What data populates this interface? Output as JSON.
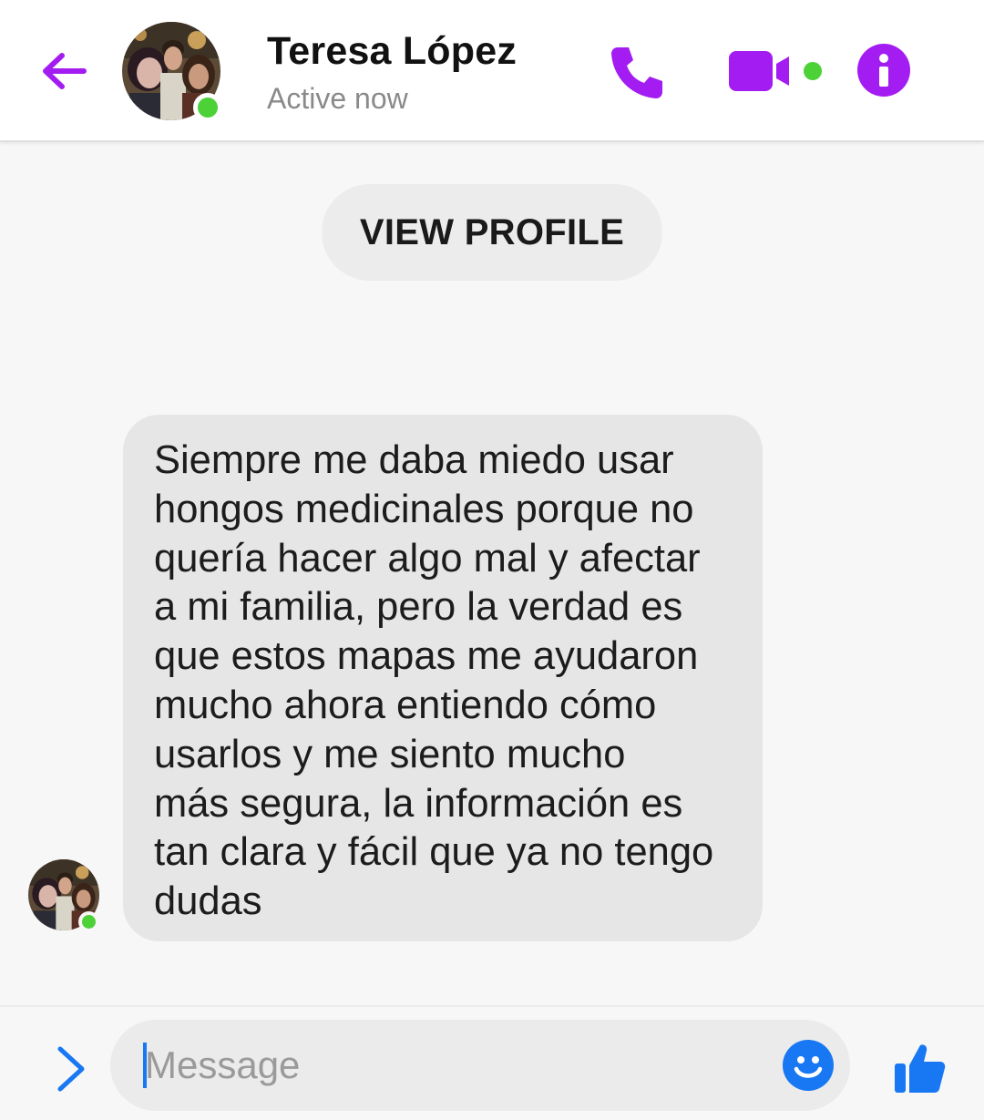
{
  "header": {
    "contact_name": "Teresa López",
    "status": "Active now"
  },
  "view_profile_label": "VIEW PROFILE",
  "message": {
    "lines": [
      "Siempre me daba miedo usar",
      "hongos medicinales porque no",
      "quería hacer algo mal y afectar",
      "a mi familia, pero la verdad es",
      "que estos mapas me ayudaron",
      "mucho ahora entiendo cómo",
      "usarlos y me siento mucho",
      "más segura, la información es",
      "tan clara y fácil que ya no tengo",
      "dudas"
    ]
  },
  "composer": {
    "placeholder": "Message"
  },
  "icons": {
    "back": "arrow-left-icon",
    "call": "phone-icon",
    "video": "video-camera-icon",
    "info": "info-icon",
    "expand": "chevron-right-icon",
    "emoji": "smiley-icon",
    "like": "thumbs-up-icon"
  },
  "colors": {
    "accent_purple": "#a31cf2",
    "accent_blue": "#1877f2",
    "presence_green": "#4cd137",
    "bubble_gray": "#e6e6e6"
  }
}
